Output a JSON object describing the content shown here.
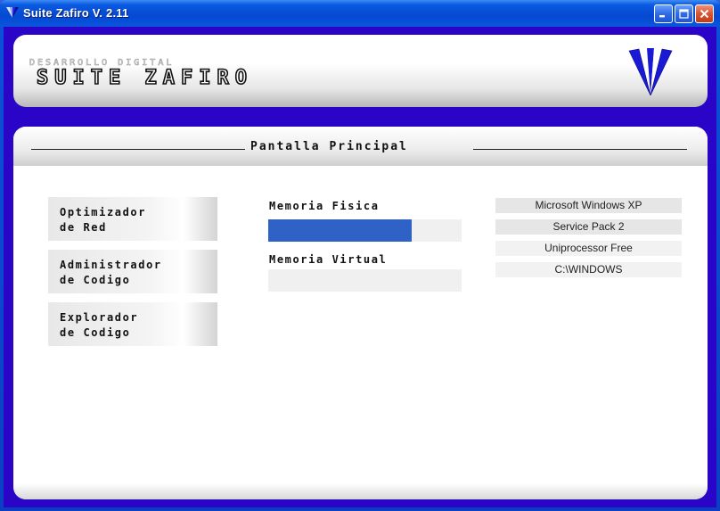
{
  "window": {
    "title": "Suite Zafiro V. 2.11",
    "controls": {
      "minimize_icon": "minimize-icon",
      "maximize_icon": "maximize-icon",
      "close_icon": "close-icon"
    }
  },
  "header": {
    "subtitle": "Desarrollo Digital",
    "brand": "Suite Zafiro",
    "logo_icon": "sapphire-gem-icon"
  },
  "main": {
    "section_title": "Pantalla Principal",
    "nav_buttons": [
      {
        "line1": "Optimizador",
        "line2": "de Red"
      },
      {
        "line1": "Administrador",
        "line2": "de Codigo"
      },
      {
        "line1": "Explorador",
        "line2": "de Codigo"
      }
    ],
    "memory": {
      "physical_label": "Memoria Fisica",
      "physical_usage": 0.74,
      "virtual_label": "Memoria Virtual",
      "virtual_usage": 0.0
    },
    "system_info": [
      "Microsoft Windows XP",
      "Service Pack 2",
      "Uniprocessor Free",
      "C:\\WINDOWS"
    ]
  },
  "colors": {
    "window_frame": "#2a05c8",
    "progress_fill": "#2f62c6",
    "logo_blue": "#1a1ad6"
  }
}
